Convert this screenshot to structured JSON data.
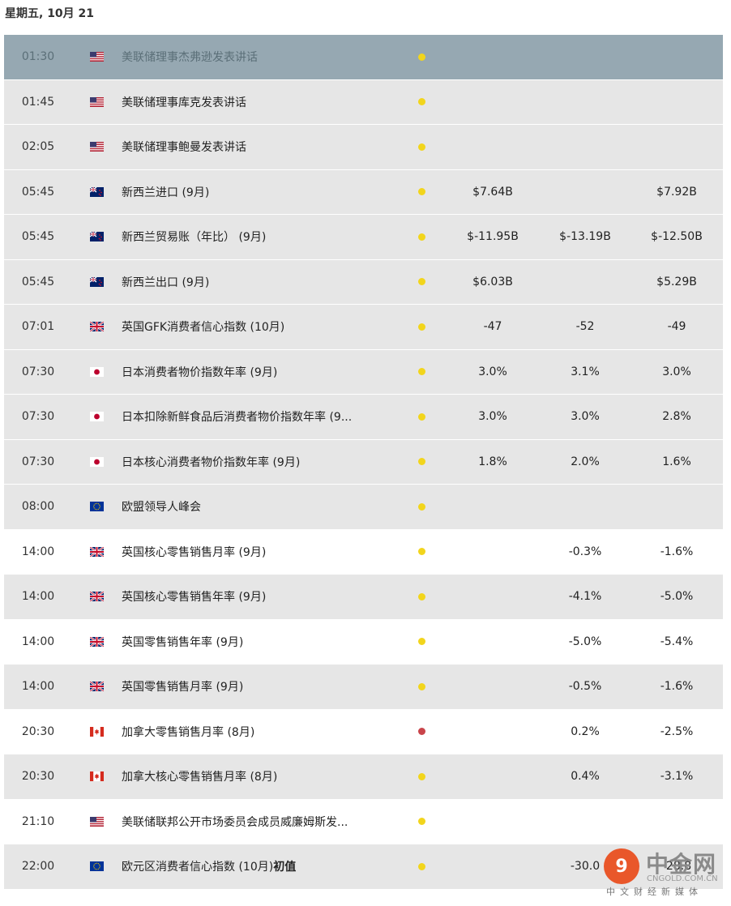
{
  "date_header": "星期五, 10月 21",
  "colors": {
    "dot_yellow": "#f2d51c",
    "dot_red": "#c9444a",
    "row_gray": "#e6e6e6",
    "row_highlight": "#96a8b2"
  },
  "events": [
    {
      "time": "01:30",
      "country": "US",
      "flag_icon": "us-flag-icon",
      "name": "美联储理事杰弗逊发表讲话",
      "name_bold": "",
      "importance": "yellow",
      "actual": "",
      "forecast": "",
      "previous": "",
      "row": "highlight"
    },
    {
      "time": "01:45",
      "country": "US",
      "flag_icon": "us-flag-icon",
      "name": "美联储理事库克发表讲话",
      "name_bold": "",
      "importance": "yellow",
      "actual": "",
      "forecast": "",
      "previous": "",
      "row": "gray"
    },
    {
      "time": "02:05",
      "country": "US",
      "flag_icon": "us-flag-icon",
      "name": "美联储理事鲍曼发表讲话",
      "name_bold": "",
      "importance": "yellow",
      "actual": "",
      "forecast": "",
      "previous": "",
      "row": "gray"
    },
    {
      "time": "05:45",
      "country": "NZ",
      "flag_icon": "nz-flag-icon",
      "name": "新西兰进口 (9月)",
      "name_bold": "",
      "importance": "yellow",
      "actual": "$7.64B",
      "forecast": "",
      "previous": "$7.92B",
      "row": "gray"
    },
    {
      "time": "05:45",
      "country": "NZ",
      "flag_icon": "nz-flag-icon",
      "name": "新西兰贸易账（年比） (9月)",
      "name_bold": "",
      "importance": "yellow",
      "actual": "$-11.95B",
      "forecast": "$-13.19B",
      "previous": "$-12.50B",
      "row": "gray"
    },
    {
      "time": "05:45",
      "country": "NZ",
      "flag_icon": "nz-flag-icon",
      "name": "新西兰出口 (9月)",
      "name_bold": "",
      "importance": "yellow",
      "actual": "$6.03B",
      "forecast": "",
      "previous": "$5.29B",
      "row": "gray"
    },
    {
      "time": "07:01",
      "country": "GB",
      "flag_icon": "uk-flag-icon",
      "name": "英国GFK消费者信心指数 (10月)",
      "name_bold": "",
      "importance": "yellow",
      "actual": "-47",
      "forecast": "-52",
      "previous": "-49",
      "row": "gray"
    },
    {
      "time": "07:30",
      "country": "JP",
      "flag_icon": "jp-flag-icon",
      "name": "日本消费者物价指数年率 (9月)",
      "name_bold": "",
      "importance": "yellow",
      "actual": "3.0%",
      "forecast": "3.1%",
      "previous": "3.0%",
      "row": "gray"
    },
    {
      "time": "07:30",
      "country": "JP",
      "flag_icon": "jp-flag-icon",
      "name": "日本扣除新鲜食品后消费者物价指数年率 (9...",
      "name_bold": "",
      "importance": "yellow",
      "actual": "3.0%",
      "forecast": "3.0%",
      "previous": "2.8%",
      "row": "gray"
    },
    {
      "time": "07:30",
      "country": "JP",
      "flag_icon": "jp-flag-icon",
      "name": "日本核心消费者物价指数年率 (9月)",
      "name_bold": "",
      "importance": "yellow",
      "actual": "1.8%",
      "forecast": "2.0%",
      "previous": "1.6%",
      "row": "gray"
    },
    {
      "time": "08:00",
      "country": "EU",
      "flag_icon": "eu-flag-icon",
      "name": "欧盟领导人峰会",
      "name_bold": "",
      "importance": "yellow",
      "actual": "",
      "forecast": "",
      "previous": "",
      "row": "gray"
    },
    {
      "time": "14:00",
      "country": "GB",
      "flag_icon": "uk-flag-icon",
      "name": "英国核心零售销售月率 (9月)",
      "name_bold": "",
      "importance": "yellow",
      "actual": "",
      "forecast": "-0.3%",
      "previous": "-1.6%",
      "row": "white"
    },
    {
      "time": "14:00",
      "country": "GB",
      "flag_icon": "uk-flag-icon",
      "name": "英国核心零售销售年率 (9月)",
      "name_bold": "",
      "importance": "yellow",
      "actual": "",
      "forecast": "-4.1%",
      "previous": "-5.0%",
      "row": "gray"
    },
    {
      "time": "14:00",
      "country": "GB",
      "flag_icon": "uk-flag-icon",
      "name": "英国零售销售年率 (9月)",
      "name_bold": "",
      "importance": "yellow",
      "actual": "",
      "forecast": "-5.0%",
      "previous": "-5.4%",
      "row": "white"
    },
    {
      "time": "14:00",
      "country": "GB",
      "flag_icon": "uk-flag-icon",
      "name": "英国零售销售月率 (9月)",
      "name_bold": "",
      "importance": "yellow",
      "actual": "",
      "forecast": "-0.5%",
      "previous": "-1.6%",
      "row": "gray"
    },
    {
      "time": "20:30",
      "country": "CA",
      "flag_icon": "ca-flag-icon",
      "name": "加拿大零售销售月率 (8月)",
      "name_bold": "",
      "importance": "red",
      "actual": "",
      "forecast": "0.2%",
      "previous": "-2.5%",
      "row": "white"
    },
    {
      "time": "20:30",
      "country": "CA",
      "flag_icon": "ca-flag-icon",
      "name": "加拿大核心零售销售月率 (8月)",
      "name_bold": "",
      "importance": "yellow",
      "actual": "",
      "forecast": "0.4%",
      "previous": "-3.1%",
      "row": "gray"
    },
    {
      "time": "21:10",
      "country": "US",
      "flag_icon": "us-flag-icon",
      "name": "美联储联邦公开市场委员会成员威廉姆斯发...",
      "name_bold": "",
      "importance": "yellow",
      "actual": "",
      "forecast": "",
      "previous": "",
      "row": "white"
    },
    {
      "time": "22:00",
      "country": "EU",
      "flag_icon": "eu-flag-icon",
      "name": "欧元区消费者信心指数 (10月)",
      "name_bold": "初值",
      "importance": "yellow",
      "actual": "",
      "forecast": "-30.0",
      "previous": "-28.8",
      "row": "gray"
    }
  ],
  "watermark": {
    "logo_glyph": "9",
    "brand": "中金网",
    "domain": "CNGOLD.COM.CN",
    "slogan": "中文财经新媒体"
  }
}
